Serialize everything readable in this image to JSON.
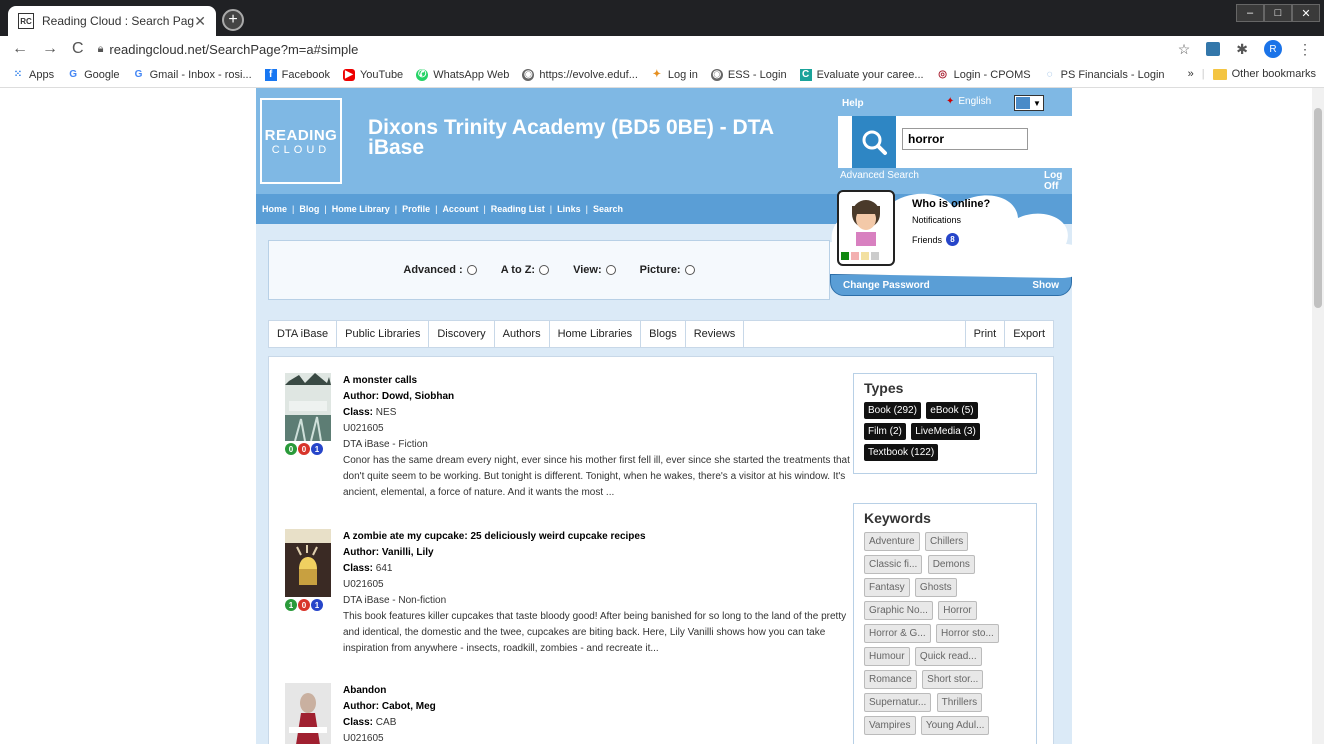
{
  "browser": {
    "tab_title": "Reading Cloud : Search Page",
    "favicon": "RC",
    "url": "readingcloud.net/SearchPage?m=a#simple",
    "profile_initial": "R",
    "bookmarks": [
      {
        "label": "Apps",
        "icon": "apps-grid-icon"
      },
      {
        "label": "Google",
        "icon": "google-icon"
      },
      {
        "label": "Gmail - Inbox - rosi...",
        "icon": "google-icon"
      },
      {
        "label": "Facebook",
        "icon": "facebook-icon"
      },
      {
        "label": "YouTube",
        "icon": "youtube-icon"
      },
      {
        "label": "WhatsApp Web",
        "icon": "whatsapp-icon"
      },
      {
        "label": "https://evolve.eduf...",
        "icon": "globe-icon"
      },
      {
        "label": "Log in",
        "icon": "star-icon"
      },
      {
        "label": "ESS - Login",
        "icon": "globe-icon"
      },
      {
        "label": "Evaluate your caree...",
        "icon": "c-icon"
      },
      {
        "label": "Login - CPOMS",
        "icon": "target-icon"
      },
      {
        "label": "PS Financials - Login",
        "icon": "ps-icon"
      }
    ],
    "more_bookmarks": "»",
    "other_bookmarks": "Other bookmarks"
  },
  "header": {
    "logo_line1": "READING",
    "logo_line2": "CLOUD",
    "school_title": "Dixons Trinity Academy (BD5 0BE) - DTA iBase",
    "help": "Help",
    "language": "English",
    "search_value": "horror",
    "advanced_search": "Advanced Search",
    "log_off": "Log Off"
  },
  "nav": [
    "Home",
    "Blog",
    "Home Library",
    "Profile",
    "Account",
    "Reading List",
    "Links",
    "Search"
  ],
  "profile_cloud": {
    "who_online": "Who is online?",
    "notifications": "Notifications",
    "friends_label": "Friends",
    "friends_count": "8",
    "change_password": "Change Password",
    "show": "Show"
  },
  "options": [
    {
      "label": "Advanced :"
    },
    {
      "label": "A to Z:"
    },
    {
      "label": "View:"
    },
    {
      "label": "Picture:"
    }
  ],
  "tabs": [
    "DTA iBase",
    "Public Libraries",
    "Discovery",
    "Authors",
    "Home Libraries",
    "Blogs",
    "Reviews"
  ],
  "tabs_right": [
    "Print",
    "Export"
  ],
  "results": [
    {
      "title": "A monster calls",
      "author_label": "Author:",
      "author": "Dowd, Siobhan",
      "class_label": "Class:",
      "class": "NES",
      "id": "U021605",
      "collection": "DTA iBase - Fiction",
      "stats": [
        "0",
        "0",
        "1"
      ],
      "description": "Conor has the same dream every night, ever since his mother first fell ill, ever since she started the treatments that don't quite seem to be working. But tonight is different. Tonight, when he wakes, there's a visitor at his window. It's ancient, elemental, a force of nature. And it wants the most ..."
    },
    {
      "title": "A zombie ate my cupcake: 25 deliciously weird cupcake recipes",
      "author_label": "Author:",
      "author": "Vanilli, Lily",
      "class_label": "Class:",
      "class": "641",
      "id": "U021605",
      "collection": "DTA iBase - Non-fiction",
      "stats": [
        "1",
        "0",
        "1"
      ],
      "description": "This book features killer cupcakes that taste bloody good! After being banished for so long to the land of the pretty and identical, the domestic and the twee, cupcakes are biting back. Here, Lily Vanilli shows how you can take inspiration from anywhere - insects, roadkill, zombies - and recreate it..."
    },
    {
      "title": "Abandon",
      "author_label": "Author:",
      "author": "Cabot, Meg",
      "class_label": "Class:",
      "class": "CAB",
      "id": "U021605"
    }
  ],
  "types": {
    "heading": "Types",
    "items": [
      "Book (292)",
      "eBook (5)",
      "Film (2)",
      "LiveMedia (3)",
      "Textbook (122)"
    ]
  },
  "keywords": {
    "heading": "Keywords",
    "items": [
      "Adventure",
      "Chillers",
      "Classic fi...",
      "Demons",
      "Fantasy",
      "Ghosts",
      "Graphic No...",
      "Horror",
      "Horror & G...",
      "Horror sto...",
      "Humour",
      "Quick read...",
      "Romance",
      "Short stor...",
      "Supernatur...",
      "Thrillers",
      "Vampires",
      "Young Adul..."
    ]
  }
}
